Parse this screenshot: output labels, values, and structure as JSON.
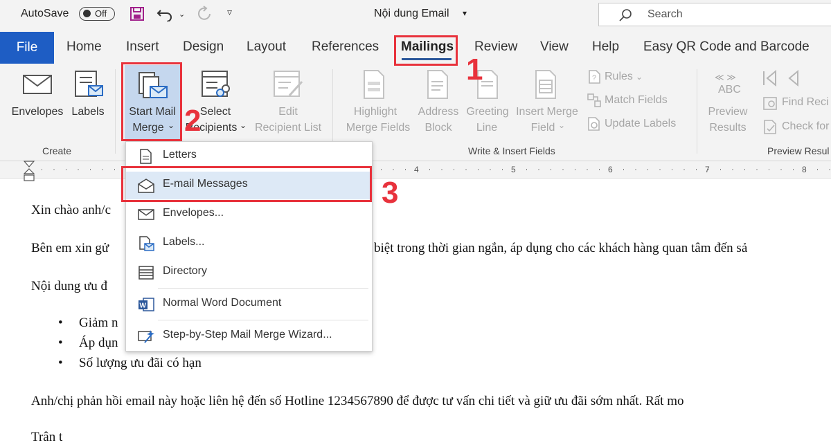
{
  "titlebar": {
    "autosave_label": "AutoSave",
    "autosave_state": "Off",
    "document_title": "Nội dung Email",
    "search_placeholder": "Search"
  },
  "tabs": [
    "File",
    "Home",
    "Insert",
    "Design",
    "Layout",
    "References",
    "Mailings",
    "Review",
    "View",
    "Help",
    "Easy QR Code and Barcode"
  ],
  "active_tab": "Mailings",
  "ribbon": {
    "create": {
      "envelopes": "Envelopes",
      "labels": "Labels",
      "group": "Create"
    },
    "start_merge": {
      "line1": "Start Mail",
      "line2": "Merge"
    },
    "select_recipients": {
      "line1": "Select",
      "line2": "Recipients"
    },
    "edit_list": {
      "line1": "Edit",
      "line2": "Recipient List"
    },
    "highlight": {
      "line1": "Highlight",
      "line2": "Merge Fields"
    },
    "address": {
      "line1": "Address",
      "line2": "Block"
    },
    "greeting": {
      "line1": "Greeting",
      "line2": "Line"
    },
    "insert_merge": {
      "line1": "Insert Merge",
      "line2": "Field"
    },
    "rules": "Rules",
    "match_fields": "Match Fields",
    "update_labels": "Update Labels",
    "write_group": "Write & Insert Fields",
    "preview": {
      "abc": "ABC",
      "line1": "Preview",
      "line2": "Results"
    },
    "find_recipient": "Find Reci",
    "check_errors": "Check for",
    "preview_group": "Preview Resul"
  },
  "ruler_numbers": [
    "4",
    "5",
    "6",
    "7",
    "8"
  ],
  "menu": {
    "items": [
      {
        "label": "Letters",
        "icon": "letter-icon"
      },
      {
        "label": "E-mail Messages",
        "icon": "email-envelope-icon"
      },
      {
        "label": "Envelopes...",
        "icon": "envelope-icon"
      },
      {
        "label": "Labels...",
        "icon": "labels-icon"
      },
      {
        "label": "Directory",
        "icon": "directory-icon"
      },
      {
        "label": "Normal Word Document",
        "icon": "word-icon"
      },
      {
        "label": "Step-by-Step Mail Merge Wizard...",
        "icon": "wizard-icon"
      }
    ]
  },
  "document": {
    "line1": "Xin chào anh/c",
    "line2_left": "Bên em xin gử",
    "line2_right": "biệt trong thời gian ngắn, áp dụng cho các khách hàng quan tâm đến sả",
    "line3": "Nội dung ưu đ",
    "bullets": [
      "Giảm n",
      "Áp dụn",
      "Số lượng ưu đãi có hạn"
    ],
    "line5": "Anh/chị phản hồi email này hoặc liên hệ đến số Hotline 1234567890 để được tư vấn chi tiết và giữ ưu đãi sớm nhất. Rất mo",
    "line6": "Trân t"
  },
  "annotations": [
    "1",
    "2",
    "3"
  ],
  "colors": {
    "file_tab": "#1e5dc4",
    "annotation": "#e8323c",
    "active_underline": "#2b579a"
  }
}
